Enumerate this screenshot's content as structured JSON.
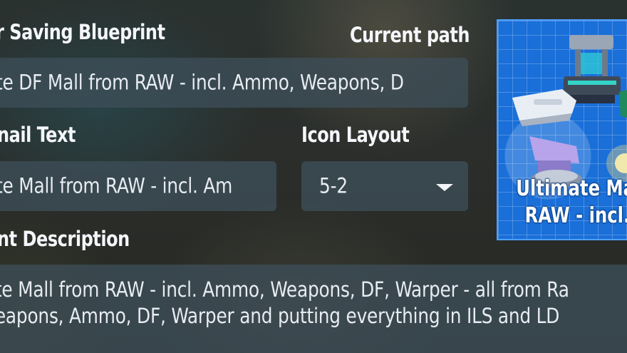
{
  "form": {
    "blueprint_label": "r Saving Blueprint",
    "current_path_button": "Current path",
    "blueprint_name_value": "te DF Mall  from RAW - incl. Ammo, Weapons, D",
    "thumbnail_text_label": "nail Text",
    "thumbnail_text_value": "te Mall  from RAW - incl. Am",
    "icon_layout_label": "Icon Layout",
    "icon_layout_value": "5-2",
    "description_label": "nt  Description",
    "description_line1": "te Mall  from RAW - incl. Ammo, Weapons, DF, Warper - all from Ra",
    "description_line2": "eapons, Ammo, DF, Warper and putting everything in ILS and LD"
  },
  "thumbnail": {
    "line1": "Ultimate Mall",
    "line2": "RAW - incl. A"
  },
  "colors": {
    "field_bg": "#3e4e58",
    "thumbnail_bg": "#1a6fd8",
    "thumbnail_border": "#4fa0ff"
  }
}
